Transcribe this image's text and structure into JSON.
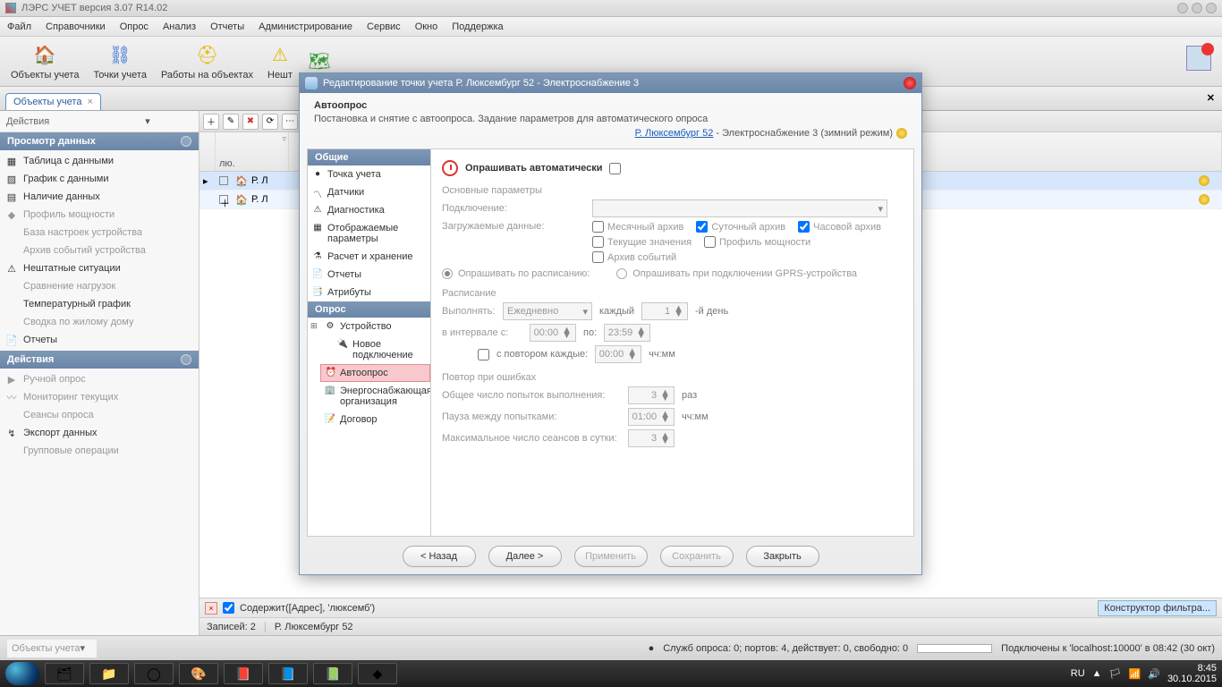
{
  "title": "ЛЭРС УЧЕТ версия 3.07 R14.02",
  "menu": [
    "Файл",
    "Справочники",
    "Опрос",
    "Анализ",
    "Отчеты",
    "Администрирование",
    "Сервис",
    "Окно",
    "Поддержка"
  ],
  "toolbar": [
    {
      "label": "Объекты учета",
      "icon": "house"
    },
    {
      "label": "Точки учета",
      "icon": "dots"
    },
    {
      "label": "Работы на объектах",
      "icon": "hat"
    },
    {
      "label": "Нешт",
      "icon": "warn"
    }
  ],
  "toolbar_extra_icon": "map",
  "right_badge_count": "1",
  "tab": {
    "label": "Объекты учета"
  },
  "sidebar": {
    "actions_label": "Действия",
    "s1": {
      "title": "Просмотр данных",
      "items": [
        {
          "t": "Таблица с данными",
          "ic": "▦",
          "dim": false
        },
        {
          "t": "График с данными",
          "ic": "▨",
          "dim": false
        },
        {
          "t": "Наличие данных",
          "ic": "▤",
          "dim": false
        },
        {
          "t": "Профиль мощности",
          "ic": "◆",
          "dim": true
        },
        {
          "t": "База настроек устройства",
          "ic": "",
          "dim": true
        },
        {
          "t": "Архив событий устройства",
          "ic": "",
          "dim": true
        },
        {
          "t": "Нештатные ситуации",
          "ic": "⚠",
          "dim": false
        },
        {
          "t": "Сравнение нагрузок",
          "ic": "",
          "dim": true
        },
        {
          "t": "Температурный график",
          "ic": "",
          "dim": false
        },
        {
          "t": "Сводка по жилому дому",
          "ic": "",
          "dim": true
        },
        {
          "t": "Отчеты",
          "ic": "📄",
          "dim": false
        }
      ]
    },
    "s2": {
      "title": "Действия",
      "items": [
        {
          "t": "Ручной опрос",
          "ic": "▶",
          "dim": true
        },
        {
          "t": "Мониторинг текущих",
          "ic": "〰",
          "dim": true
        },
        {
          "t": "Сеансы опроса",
          "ic": "",
          "dim": true
        },
        {
          "t": "Экспорт данных",
          "ic": "↯",
          "dim": false
        },
        {
          "t": "Групповые операции",
          "ic": "",
          "dim": true
        }
      ]
    }
  },
  "grid": {
    "filter_bar": "Содержит([Адрес], 'люксемб')",
    "builder": "Конструктор фильтра...",
    "col0": "лю.",
    "col1": "Р. Л",
    "col2_prefix": "Р. Л",
    "records": "Записей: 2",
    "current": "Р. Люксембург 52"
  },
  "app_status": {
    "left": "Объекты учета",
    "poll": "Служб опроса: 0; портов: 4, действует: 0, свободно: 0",
    "conn": "Подключены к 'localhost:10000' в 08:42 (30 окт)"
  },
  "taskbar": {
    "lang": "RU",
    "time": "8:45",
    "date": "30.10.2015"
  },
  "dialog": {
    "title": "Редактирование точки учета Р. Люксембург 52 - Электроснабжение 3",
    "h1": "Автоопрос",
    "h2": "Постановка и снятие с автоопроса. Задание параметров для автоматического опроса",
    "crumb_link": "Р. Люксембург 52",
    "crumb_rest": " - Электроснабжение 3 (зимний режим)",
    "nav": {
      "s1": "Общие",
      "s1_items": [
        "Точка учета",
        "Датчики",
        "Диагностика",
        "Отображаемые параметры",
        "Расчет и хранение",
        "Отчеты",
        "Атрибуты"
      ],
      "s2": "Опрос",
      "s2_device": "Устройство",
      "s2_newconn": "Новое подключение",
      "s2_auto": "Автоопрос",
      "s2_org": "Энергоснабжающая организация",
      "s2_contract": "Договор"
    },
    "content": {
      "auto_poll": "Опрашивать автоматически",
      "g1": "Основные параметры",
      "conn": "Подключение:",
      "load": "Загружаемые данные:",
      "chk": [
        "Месячный архив",
        "Суточный архив",
        "Часовой архив",
        "Текущие значения",
        "Профиль мощности",
        "Архив событий"
      ],
      "chk_checked": [
        false,
        true,
        true,
        false,
        false,
        false
      ],
      "r1": "Опрашивать по расписанию:",
      "r2": "Опрашивать при подключении GPRS-устройства",
      "g2": "Расписание",
      "perform": "Выполнять:",
      "perform_val": "Ежедневно",
      "every": "каждый",
      "every_val": "1",
      "every_suffix": "-й день",
      "interval": "в интервале с:",
      "time_from": "00:00",
      "to": "по:",
      "time_to": "23:59",
      "repeat_every": "с повтором каждые:",
      "repeat_val": "00:00",
      "hhmm": "чч:мм",
      "g3": "Повтор при ошибках",
      "attempts": "Общее число попыток выполнения:",
      "attempts_val": "3",
      "attempts_unit": "раз",
      "pause": "Пауза между попытками:",
      "pause_val": "01:00",
      "max": "Максимальное число сеансов в сутки:",
      "max_val": "3"
    },
    "buttons": {
      "back": "< Назад",
      "next": "Далее >",
      "apply": "Применить",
      "save": "Сохранить",
      "close": "Закрыть"
    }
  }
}
